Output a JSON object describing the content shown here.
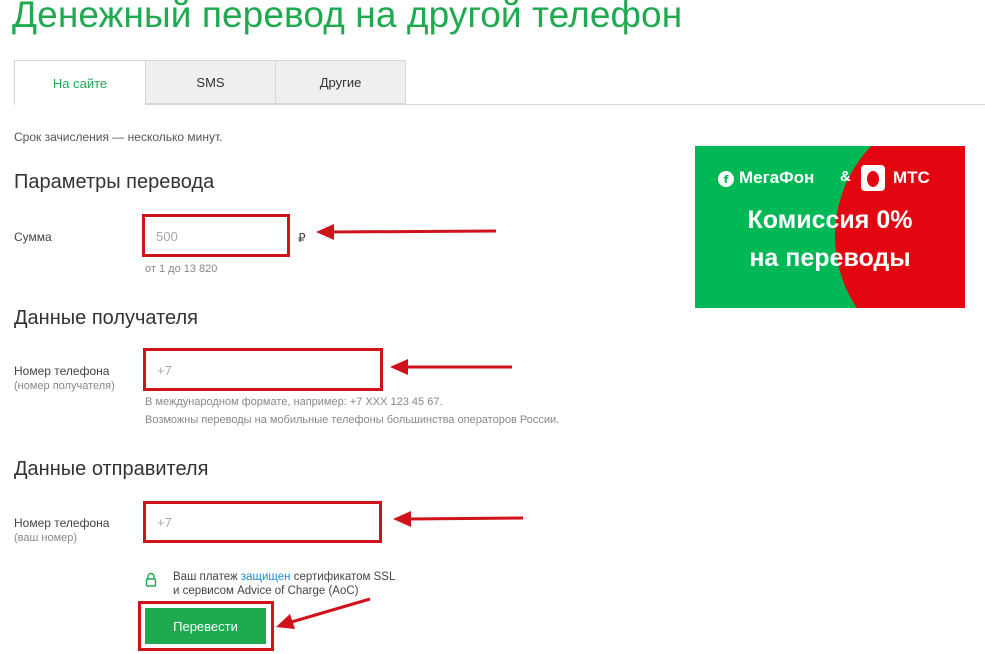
{
  "page": {
    "title": "Денежный перевод на другой телефон"
  },
  "tabs": [
    {
      "label": "На сайте",
      "active": true
    },
    {
      "label": "SMS",
      "active": false
    },
    {
      "label": "Другие",
      "active": false
    }
  ],
  "note": "Срок зачисления — несколько минут.",
  "sections": {
    "params": {
      "title": "Параметры перевода",
      "amount_label": "Сумма",
      "amount_placeholder": "500",
      "currency": "₽",
      "amount_hint": "от 1 до 13 820"
    },
    "recipient": {
      "title": "Данные получателя",
      "phone_label": "Номер телефона",
      "phone_sublabel": "(номер получателя)",
      "phone_placeholder": "+7",
      "hint_line1": "В международном формате, например: +7 XXX 123 45 67.",
      "hint_line2": "Возможны переводы на мобильные телефоны большинства операторов России."
    },
    "sender": {
      "title": "Данные отправителя",
      "phone_label": "Номер телефона",
      "phone_sublabel": "(ваш номер)",
      "phone_placeholder": "+7"
    }
  },
  "security": {
    "text_before": "Ваш платеж ",
    "link": "защищен",
    "text_after": " сертификатом SSL",
    "line2": "и сервисом Advice of Charge (AoC)"
  },
  "submit_label": "Перевести",
  "banner": {
    "brand_left": "МегаФон",
    "ampersand": "&",
    "brand_right": "МТС",
    "line1": "Комиссия 0%",
    "line2": "на переводы"
  },
  "colors": {
    "accent_green": "#1faa4f",
    "highlight_red": "#d0121b",
    "megafon_green": "#00b956",
    "mts_red": "#e30611",
    "link_blue": "#1a8fd6"
  }
}
